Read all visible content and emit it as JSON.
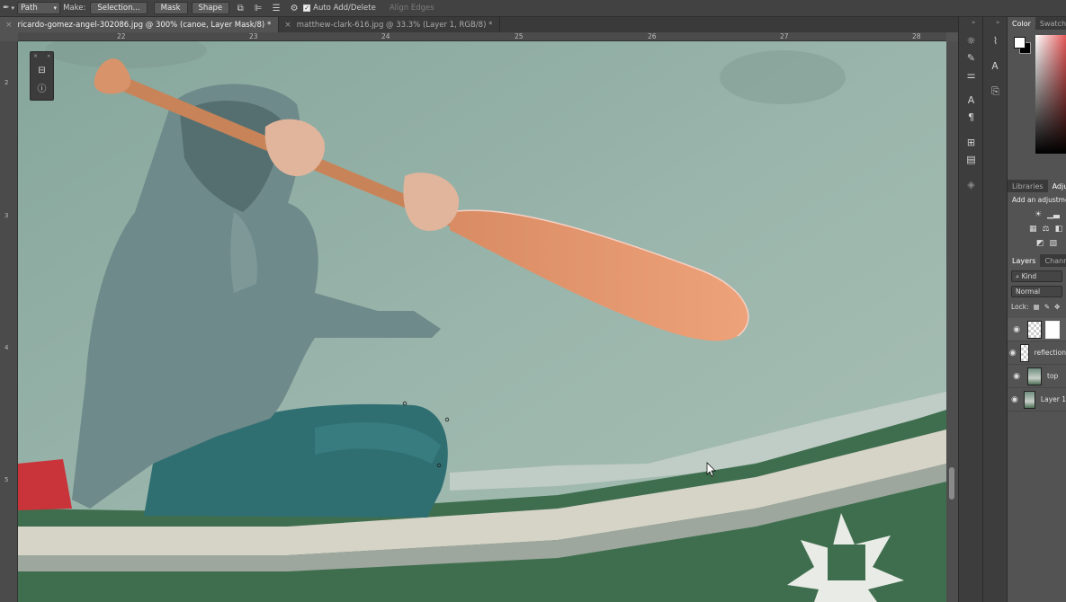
{
  "options_bar": {
    "tool_mode": "Path",
    "make_label": "Make:",
    "selection_button": "Selection...",
    "mask_button": "Mask",
    "shape_button": "Shape",
    "auto_add_delete": "Auto Add/Delete",
    "auto_add_delete_checked": true,
    "align_edges": "Align Edges"
  },
  "tabs": [
    {
      "title": "ricardo-gomez-angel-302086.jpg @ 300% (canoe, Layer Mask/8) *",
      "active": true
    },
    {
      "title": "matthew-clark-616.jpg @ 33.3% (Layer 1, RGB/8) *",
      "active": false
    }
  ],
  "ruler_top": [
    "22",
    "23",
    "24",
    "25",
    "26",
    "27",
    "28"
  ],
  "ruler_left": [
    "2",
    "3",
    "4",
    "5"
  ],
  "panels": {
    "color_tabs": [
      "Color",
      "Swatches"
    ],
    "mid_tabs": [
      "Libraries",
      "Adjustments"
    ],
    "adjustments_hint": "Add an adjustment",
    "layers_tabs": [
      "Layers",
      "Channels"
    ],
    "filter_kind": "Kind",
    "blend_mode": "Normal",
    "lock_label": "Lock:",
    "layers": [
      {
        "name": "",
        "selected": true,
        "has_mask": true
      },
      {
        "name": "reflection",
        "selected": false
      },
      {
        "name": "top",
        "selected": false
      },
      {
        "name": "Layer 1",
        "selected": false
      }
    ]
  },
  "colors": {
    "foreground": "#ffffff",
    "background": "#000000",
    "water": "#9cb6ac",
    "paddle": "#e49a6f",
    "hoodie": "#6e8a8a",
    "jeans": "#2f6f72",
    "canoe": "#3f6e4e"
  }
}
